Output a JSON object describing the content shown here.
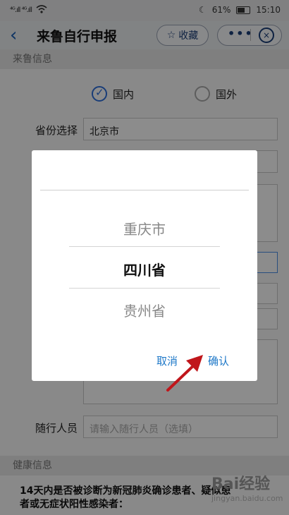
{
  "status_bar": {
    "signal": "⁴ᴳ.ıll ⁴ᴳ.ıll",
    "battery_pct": "61%",
    "time": "15:10"
  },
  "nav": {
    "title": "来鲁自行申报",
    "favorite_label": "收藏",
    "more_label": "•••"
  },
  "section_visit": {
    "title": "来鲁信息"
  },
  "radio": {
    "domestic": "国内",
    "abroad": "国外",
    "selected": "国内"
  },
  "province": {
    "label": "省份选择",
    "value": "北京市"
  },
  "companion": {
    "label": "随行人员",
    "placeholder": "请输入随行人员（选填）"
  },
  "section_health": {
    "title": "健康信息"
  },
  "health_question": "14天内是否被诊断为新冠肺炎确诊患者、疑似患者或无症状阳性感染者：",
  "picker": {
    "options": [
      "重庆市",
      "四川省",
      "贵州省"
    ],
    "selected": "四川省",
    "cancel": "取消",
    "confirm": "确认"
  },
  "watermark": {
    "brand": "Bai经验",
    "url": "jingyan.baidu.com"
  }
}
